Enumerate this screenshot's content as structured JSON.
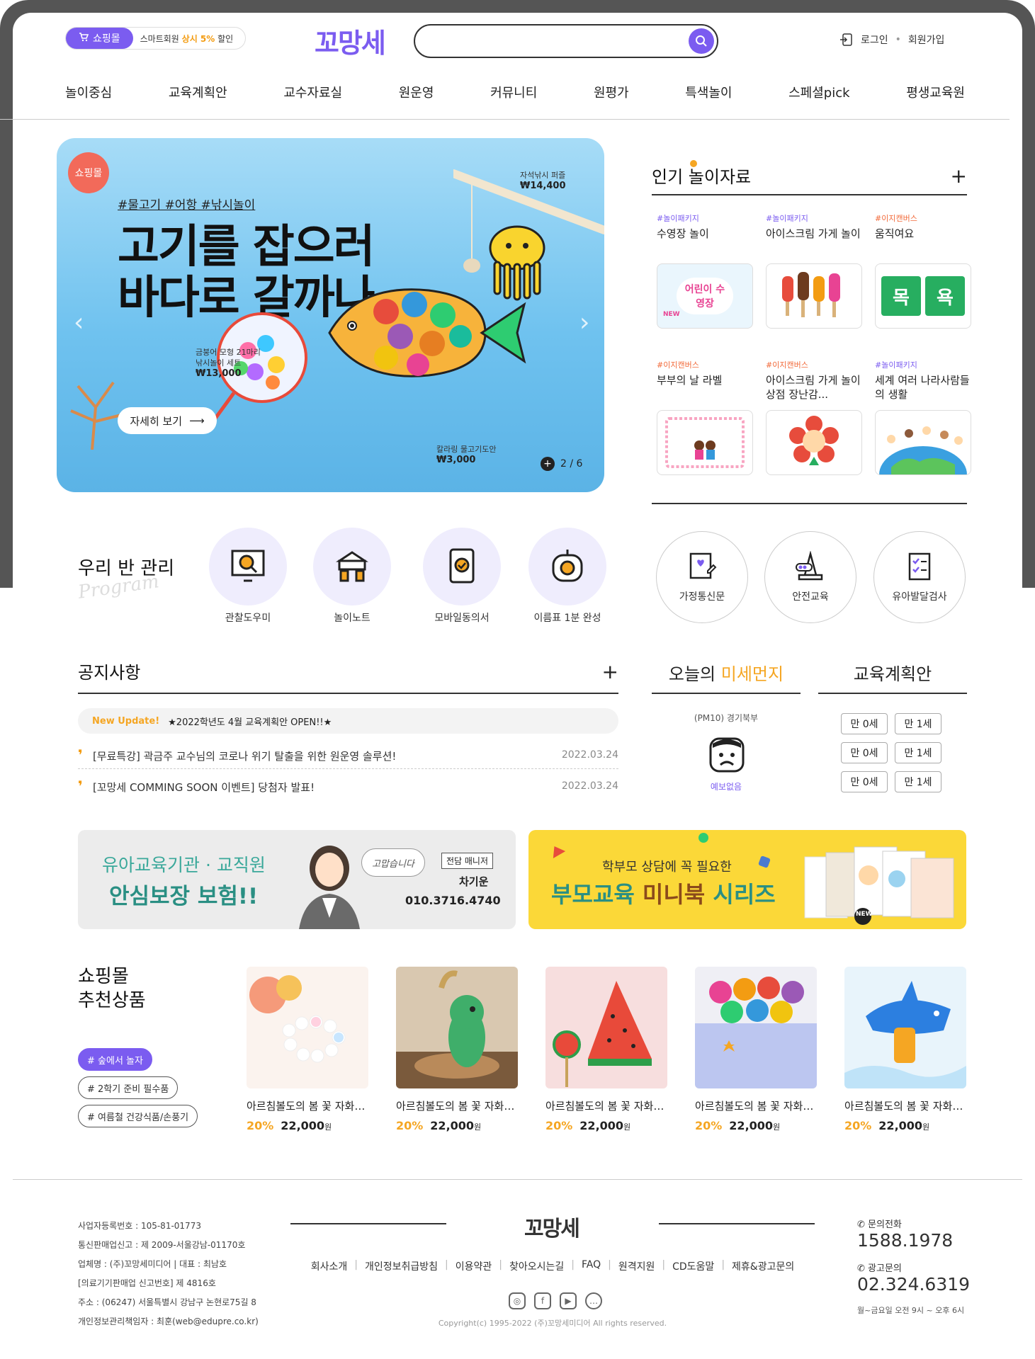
{
  "header": {
    "mall_tag": "쇼핑몰",
    "mall_text_pre": "스마트회원 ",
    "mall_text_hl": "상시 5%",
    "mall_text_post": " 할인",
    "logo": "꼬망세",
    "search": {
      "placeholder": ""
    },
    "login": "로그인",
    "signup": "회원가입"
  },
  "nav": [
    "놀이중심",
    "교육계획안",
    "교수자료실",
    "원운영",
    "커뮤니티",
    "원평가",
    "특색놀이",
    "스페셜pick",
    "평생교육원"
  ],
  "hero": {
    "badge": "쇼핑몰",
    "tags": "#물고기 #어항 #낚시놀이",
    "headline_1": "고기를 잡으러",
    "headline_2": "바다로 갈까나",
    "cta": "자세히 보기",
    "cta_arrow": "⟶",
    "item1_name": "자석낚시 퍼즐",
    "item1_price": "14,400",
    "item2_name_1": "금붕어 모형 21마리",
    "item2_name_2": "낚시놀이 세트",
    "item2_price": "13,000",
    "item3_name": "칼라링 물고기도안",
    "item3_price": "3,000",
    "won": "₩",
    "pager": "2 / 6",
    "plus": "+",
    "prev": "‹",
    "next": "›"
  },
  "popular": {
    "title": "인기 놀이자료",
    "plus": "+",
    "items": [
      {
        "cat": "#놀이패키지",
        "title": "수영장 놀이",
        "thumb": "어린이 수영장",
        "thumb_sub": "NEW"
      },
      {
        "cat": "#놀이패키지",
        "title": "아이스크림 가게 놀이",
        "thumb": ""
      },
      {
        "cat": "#이지캔버스",
        "title": "움직여요",
        "thumb_a": "목",
        "thumb_b": "욕"
      },
      {
        "cat": "#이지캔버스",
        "title": "부부의 날 라벨",
        "thumb": ""
      },
      {
        "cat": "#이지캔버스",
        "title": "아이스크림 가게 놀이 상점 장난감...",
        "thumb": ""
      },
      {
        "cat": "#놀이패키지",
        "title": "세계 여러 나라사람들의 생활",
        "thumb": ""
      }
    ]
  },
  "class_mgmt": {
    "title": "우리 반 관리",
    "subtitle": "Program",
    "items": [
      "관찰도우미",
      "놀이노트",
      "모바일동의서",
      "이름표 1분 완성"
    ],
    "rings": [
      "가정통신문",
      "안전교육",
      "유아발달검사"
    ]
  },
  "notice": {
    "title": "공지사항",
    "plus": "+",
    "update_tag": "New Update!",
    "update_text": "★2022학년도 4월 교육계획안 OPEN!!★",
    "rows": [
      {
        "text": "[무료특강] 곽금주 교수님의 코로나 위기 탈출을 위한 원운영 솔루션!",
        "date": "2022.03.24"
      },
      {
        "text": "[꼬망세 COMMING SOON 이벤트] 당첨자 발표!",
        "date": "2022.03.24"
      }
    ]
  },
  "dust": {
    "title_pre": "오늘의 ",
    "title_hl": "미세먼지",
    "region": "(PM10) 경기북부",
    "status": "예보없음"
  },
  "edu_plan": {
    "title": "교육계획안",
    "ages": [
      [
        "만 0세",
        "만 1세"
      ],
      [
        "만 0세",
        "만 1세"
      ],
      [
        "만 0세",
        "만 1세"
      ]
    ]
  },
  "banner_insurance": {
    "line1": "유아교육기관 · 교직원",
    "line2": "안심보장 보험!!",
    "bubble": "고맙습니다",
    "manager_tag": "전담 매니저",
    "manager_name": "차기운",
    "phone": "010.3716.4740"
  },
  "banner_book": {
    "line1": "학부모 상담에 꼭 필요한",
    "line2_a": "부모교육 ",
    "line2_b": "미니북",
    "line2_c": " 시리즈",
    "new": "NEW"
  },
  "shop": {
    "title_1": "쇼핑몰",
    "title_2": "추천상품",
    "chips": [
      "# 숲에서 놀자",
      "# 2학기 준비 필수품",
      "# 여름철 건강식품/손풍기"
    ],
    "products": [
      {
        "name": "아르침볼도의 봄 꽃 자화상 만들기",
        "discount": "20%",
        "price": "22,000",
        "unit": "원"
      },
      {
        "name": "아르침볼도의 봄 꽃 자화상 만들기",
        "discount": "20%",
        "price": "22,000",
        "unit": "원"
      },
      {
        "name": "아르침볼도의 봄 꽃 자화상 만들기",
        "discount": "20%",
        "price": "22,000",
        "unit": "원"
      },
      {
        "name": "아르침볼도의 봄 꽃 자화상 만들기",
        "discount": "20%",
        "price": "22,000",
        "unit": "원"
      },
      {
        "name": "아르침볼도의 봄 꽃 자화상 만들기",
        "discount": "20%",
        "price": "22,000",
        "unit": "원"
      }
    ]
  },
  "footer": {
    "info": [
      "사업자등록번호 : 105-81-01773",
      "통신판매업신고 : 제 2009-서울강남-01170호",
      "업체명 : (주)꼬망세미디어 | 대표 : 최남호",
      "[의료기기판매업 신고번호] 제 4816호",
      "주소 : (06247) 서울특별시 강남구 논현로75길 8",
      "개인정보관리책임자 : 최훈(web@edupre.co.kr)"
    ],
    "logo": "꼬망세",
    "links": [
      "회사소개",
      "개인정보취급방침",
      "이용약관",
      "찾아오시는길",
      "FAQ",
      "원격지원",
      "CD도움말",
      "제휴&광고문의"
    ],
    "copyright": "Copyright(c) 1995-2022 (주)꼬망세미디어 All rights reserved.",
    "tel_label": "문의전화",
    "tel": "1588.1978",
    "ad_label": "광고문의",
    "ad_tel": "02.324.6319",
    "hours": "월~금요일 오전 9시 ~ 오후 6시"
  },
  "colors": {
    "brand": "#7b5cf0",
    "accent": "#f5a623",
    "hero_bg": "#6fc2ef",
    "banner_yellow": "#fbd838"
  }
}
